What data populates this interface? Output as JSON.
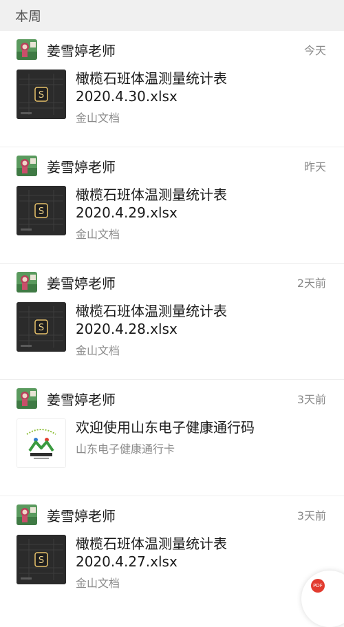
{
  "section": {
    "title": "本周"
  },
  "items": [
    {
      "sender": "姜雪婷老师",
      "time": "今天",
      "title": "橄榄石班体温测量统计表\n2020.4.30.xlsx",
      "source": "金山文档",
      "thumb": "spreadsheet-thumbnail"
    },
    {
      "sender": "姜雪婷老师",
      "time": "昨天",
      "title": "橄榄石班体温测量统计表\n2020.4.29.xlsx",
      "source": "金山文档",
      "thumb": "spreadsheet-thumbnail"
    },
    {
      "sender": "姜雪婷老师",
      "time": "2天前",
      "title": "橄榄石班体温测量统计表\n2020.4.28.xlsx",
      "source": "金山文档",
      "thumb": "spreadsheet-thumbnail"
    },
    {
      "sender": "姜雪婷老师",
      "time": "3天前",
      "title": "欢迎使用山东电子健康通行码",
      "source": "山东电子健康通行卡",
      "thumb": "health-code-logo"
    },
    {
      "sender": "姜雪婷老师",
      "time": "3天前",
      "title": "橄榄石班体温测量统计表\n2020.4.27.xlsx",
      "source": "金山文档",
      "thumb": "spreadsheet-thumbnail"
    }
  ],
  "fab": {
    "label": "PDF"
  },
  "colors": {
    "header_bg": "#f0f0f0",
    "secondary_text": "#8a8a8a",
    "thumb_dark": "#2b2b2b",
    "pdf_red": "#e23b2f"
  }
}
